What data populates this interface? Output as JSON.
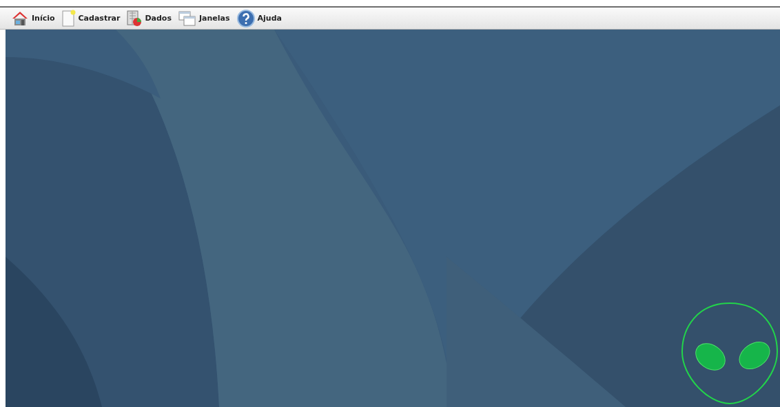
{
  "toolbar": {
    "items": [
      {
        "label": "Início"
      },
      {
        "label": "Cadastrar"
      },
      {
        "label": "Dados"
      },
      {
        "label": "Janelas"
      },
      {
        "label": "Ajuda"
      }
    ]
  }
}
